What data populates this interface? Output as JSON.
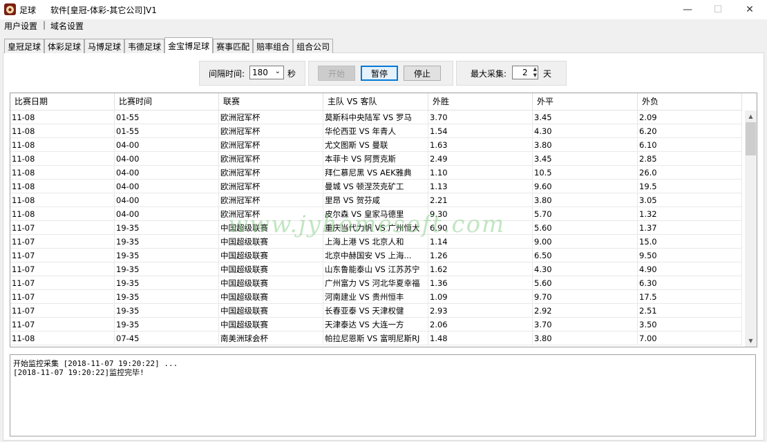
{
  "window": {
    "app_name": "足球",
    "title": "软件[皇冠-体彩-其它公司]V1",
    "minimize": "—",
    "maximize": "☐",
    "close": "✕"
  },
  "menu": [
    "用户设置",
    "域名设置"
  ],
  "menu_separator": "|",
  "tabs": [
    "皇冠足球",
    "体彩足球",
    "马博足球",
    "韦德足球",
    "金宝博足球",
    "赛事匹配",
    "赔率组合",
    "组合公司"
  ],
  "active_tab": 4,
  "controls": {
    "interval_label": "间隔时间:",
    "interval_value": "180",
    "interval_unit": "秒",
    "start_label": "开始",
    "pause_label": "暂停",
    "stop_label": "停止",
    "max_label": "最大采集:",
    "max_value": "2",
    "max_unit": "天"
  },
  "table": {
    "columns": [
      "比赛日期",
      "比赛时间",
      "联赛",
      "主队 VS 客队",
      "外胜",
      "外平",
      "外负"
    ],
    "rows": [
      [
        "11-08",
        "01-55",
        "欧洲冠军杯",
        "莫斯科中央陆军 VS 罗马",
        "3.70",
        "3.45",
        "2.09"
      ],
      [
        "11-08",
        "01-55",
        "欧洲冠军杯",
        "华伦西亚 VS 年青人",
        "1.54",
        "4.30",
        "6.20"
      ],
      [
        "11-08",
        "04-00",
        "欧洲冠军杯",
        "尤文图斯 VS 曼联",
        "1.63",
        "3.80",
        "6.10"
      ],
      [
        "11-08",
        "04-00",
        "欧洲冠军杯",
        "本菲卡 VS 阿贾克斯",
        "2.49",
        "3.45",
        "2.85"
      ],
      [
        "11-08",
        "04-00",
        "欧洲冠军杯",
        "拜仁慕尼黑 VS AEK雅典",
        "1.10",
        "10.5",
        "26.0"
      ],
      [
        "11-08",
        "04-00",
        "欧洲冠军杯",
        "曼城 VS 顿涅茨克矿工",
        "1.13",
        "9.60",
        "19.5"
      ],
      [
        "11-08",
        "04-00",
        "欧洲冠军杯",
        "里昂 VS 贺芬咸",
        "2.21",
        "3.80",
        "3.05"
      ],
      [
        "11-08",
        "04-00",
        "欧洲冠军杯",
        "皮尔森 VS 皇家马德里",
        "9.30",
        "5.70",
        "1.32"
      ],
      [
        "11-07",
        "19-35",
        "中国超级联赛",
        "重庆当代力帆 VS 广州恒大",
        "6.90",
        "5.60",
        "1.37"
      ],
      [
        "11-07",
        "19-35",
        "中国超级联赛",
        "上海上港 VS 北京人和",
        "1.14",
        "9.00",
        "15.0"
      ],
      [
        "11-07",
        "19-35",
        "中国超级联赛",
        "北京中赫国安 VS 上海...",
        "1.26",
        "6.50",
        "9.50"
      ],
      [
        "11-07",
        "19-35",
        "中国超级联赛",
        "山东鲁能泰山 VS 江苏苏宁",
        "1.62",
        "4.30",
        "4.90"
      ],
      [
        "11-07",
        "19-35",
        "中国超级联赛",
        "广州富力 VS 河北华夏幸福",
        "1.36",
        "5.60",
        "6.30"
      ],
      [
        "11-07",
        "19-35",
        "中国超级联赛",
        "河南建业 VS 贵州恒丰",
        "1.09",
        "9.70",
        "17.5"
      ],
      [
        "11-07",
        "19-35",
        "中国超级联赛",
        "长春亚泰 VS 天津权健",
        "2.93",
        "2.92",
        "2.51"
      ],
      [
        "11-07",
        "19-35",
        "中国超级联赛",
        "天津泰达 VS 大连一方",
        "2.06",
        "3.70",
        "3.50"
      ],
      [
        "11-08",
        "07-45",
        "南美洲球会杯",
        "帕拉尼恩斯 VS 富明尼斯RJ",
        "1.48",
        "3.80",
        "7.00"
      ]
    ]
  },
  "watermark": "www.jyhomesoft.com",
  "log": [
    "开始监控采集 [2018-11-07 19:20:22] ...",
    "[2018-11-07 19:20:22]监控完毕!"
  ]
}
